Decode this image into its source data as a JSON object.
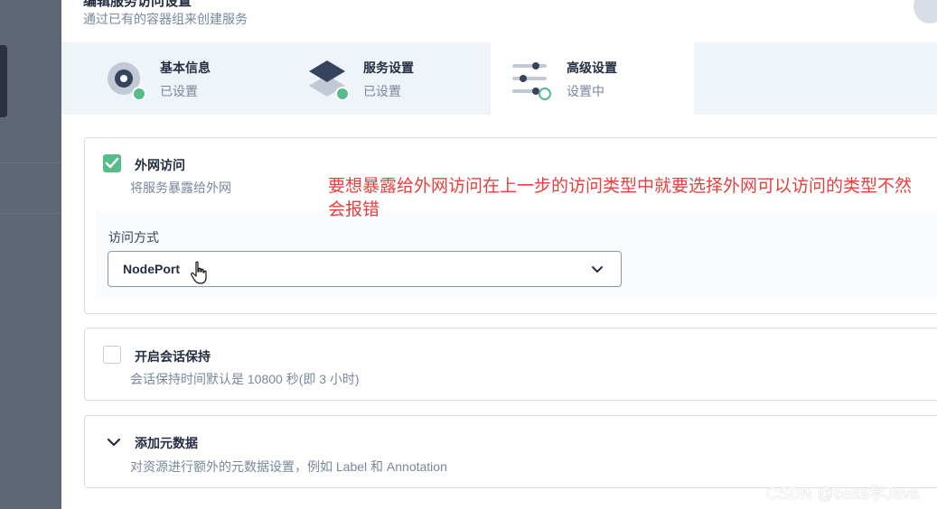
{
  "header": {
    "title": "编辑服务访问设置",
    "description": "通过已有的容器组来创建服务"
  },
  "steps": [
    {
      "title": "基本信息",
      "status": "已设置",
      "icon": "info-circle-icon",
      "state": "done"
    },
    {
      "title": "服务设置",
      "status": "已设置",
      "icon": "stack-layers-icon",
      "state": "done"
    },
    {
      "title": "高级设置",
      "status": "设置中",
      "icon": "sliders-icon",
      "state": "current"
    }
  ],
  "external_access": {
    "checked": true,
    "title": "外网访问",
    "description": "将服务暴露给外网",
    "access_method_label": "访问方式",
    "access_method_value": "NodePort"
  },
  "session_affinity": {
    "checked": false,
    "title": "开启会话保持",
    "description": "会话保持时间默认是 10800 秒(即 3 小时)"
  },
  "metadata": {
    "title": "添加元数据",
    "description": "对资源进行额外的元数据设置，例如 Label 和 Annotation"
  },
  "annotation": {
    "text": "要想暴露给外网访问在上一步的访问类型中就要选择外网可以访问的类型不然会报错",
    "color": "#e83e3e"
  },
  "watermark": "CSDN @beita学Java",
  "colors": {
    "accent_green": "#55bc8a",
    "primary_dark": "#242e42",
    "secondary_text": "#79879c"
  }
}
